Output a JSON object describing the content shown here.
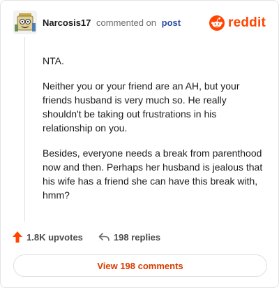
{
  "comment": {
    "username": "Narcosis17",
    "action_text": "commented on",
    "post_link": "post",
    "brand": "reddit",
    "paragraphs": [
      "NTA.",
      "Neither you or your friend are an AH, but your friends husband is very much so. He really shouldn't be taking out frustrations in his relationship on you.",
      "Besides, everyone needs a break from parenthood now and then. Perhaps her husband is jealous that his wife has a friend she can have this break with, hmm?"
    ]
  },
  "footer": {
    "upvotes": "1.8K upvotes",
    "replies": "198 replies",
    "view_button": "View 198 comments"
  },
  "icons": {
    "avatar": "avatar-icon",
    "brand": "reddit-logo-icon",
    "upvote": "upvote-arrow-icon",
    "reply": "reply-arrow-icon"
  },
  "colors": {
    "brand_orange": "#ff4500",
    "link_blue": "#2b4ea8",
    "button_text": "#d93a00"
  }
}
